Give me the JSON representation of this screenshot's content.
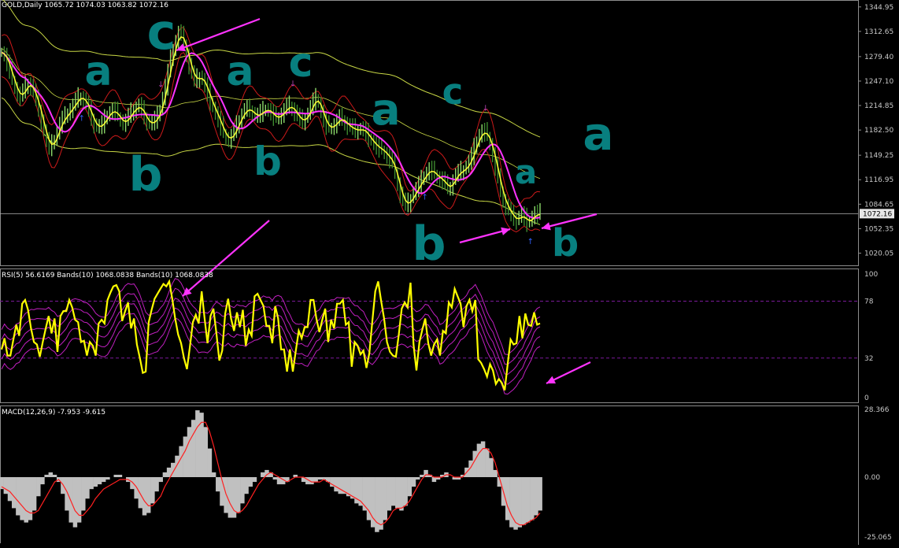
{
  "headers": {
    "price": "GOLD,Daily  1065.72 1074.03 1063.82 1072.16",
    "rsi": "RSI(5) 56.6169  Bands(10) 1068.0838  Bands(10) 1068.0838",
    "macd": "MACD(12,26,9) -7.953 -9.615"
  },
  "colors": {
    "background": "#000000",
    "candle_up": "#8cd96a",
    "candle_down": "#3d8a2f",
    "ma_fast": "#ffff33",
    "ma_slow": "#ff33ff",
    "envelope": "#cc1a1a",
    "channel": "#c9d845",
    "rsi": "#ffff00",
    "rsi_bands": "#c020c0",
    "macd_hist": "#c0c0c0",
    "macd_signal": "#ff2020",
    "annotation": "#ff33ff",
    "teal": "#087f7f",
    "axis_text": "#c8c8c8"
  },
  "chart_data": [
    {
      "type": "candlestick",
      "title": "GOLD,Daily",
      "ohlc_last": {
        "open": 1065.72,
        "high": 1074.03,
        "low": 1063.82,
        "close": 1072.16
      },
      "ylim": [
        1005,
        1352
      ],
      "ytick_labels": [
        "1344.95",
        "1312.65",
        "1279.40",
        "1247.10",
        "1214.85",
        "1182.50",
        "1149.25",
        "1116.95",
        "1084.65",
        "1052.35",
        "1020.05"
      ],
      "current_price_label": "1072.16",
      "close_series": [
        1285,
        1281,
        1270,
        1262,
        1248,
        1238,
        1230,
        1226,
        1232,
        1240,
        1244,
        1240,
        1232,
        1222,
        1210,
        1195,
        1180,
        1168,
        1160,
        1163,
        1170,
        1180,
        1190,
        1196,
        1200,
        1205,
        1210,
        1214,
        1220,
        1225,
        1226,
        1222,
        1216,
        1208,
        1198,
        1190,
        1186,
        1187,
        1190,
        1196,
        1202,
        1206,
        1208,
        1206,
        1200,
        1195,
        1192,
        1194,
        1200,
        1205,
        1210,
        1212,
        1214,
        1208,
        1200,
        1194,
        1190,
        1192,
        1196,
        1200,
        1210,
        1225,
        1240,
        1258,
        1275,
        1290,
        1300,
        1310,
        1306,
        1296,
        1282,
        1268,
        1256,
        1248,
        1250,
        1253,
        1248,
        1240,
        1230,
        1220,
        1212,
        1204,
        1196,
        1187,
        1178,
        1172,
        1170,
        1174,
        1180,
        1188,
        1196,
        1203,
        1208,
        1210,
        1209,
        1205,
        1200,
        1202,
        1205,
        1207,
        1210,
        1208,
        1205,
        1200,
        1198,
        1200,
        1204,
        1208,
        1212,
        1214,
        1211,
        1206,
        1200,
        1196,
        1194,
        1198,
        1204,
        1212,
        1220,
        1224,
        1218,
        1206,
        1196,
        1188,
        1185,
        1186,
        1190,
        1194,
        1198,
        1196,
        1192,
        1188,
        1186,
        1184,
        1182,
        1182,
        1184,
        1182,
        1178,
        1172,
        1168,
        1164,
        1160,
        1158,
        1156,
        1152,
        1148,
        1144,
        1138,
        1126,
        1112,
        1098,
        1088,
        1084,
        1086,
        1092,
        1098,
        1104,
        1110,
        1116,
        1122,
        1126,
        1130,
        1128,
        1124,
        1120,
        1118,
        1116,
        1110,
        1106,
        1108,
        1116,
        1122,
        1126,
        1128,
        1130,
        1134,
        1140,
        1148,
        1158,
        1168,
        1176,
        1180,
        1179,
        1174,
        1164,
        1150,
        1134,
        1118,
        1102,
        1090,
        1082,
        1076,
        1070,
        1066,
        1063,
        1068,
        1070,
        1066,
        1060,
        1063,
        1068,
        1072,
        1070,
        1072
      ],
      "overlays": [
        "moving average (yellow)",
        "moving average (magenta)",
        "envelope bands (red)",
        "channel (yellow-green)"
      ],
      "annotations": {
        "wave_labels": [
          "c",
          "a",
          "a",
          "c",
          "b",
          "b",
          "a",
          "c",
          "b",
          "a",
          "b",
          "a",
          "b"
        ],
        "fractal_marker": "↑",
        "arrows": 4
      }
    },
    {
      "type": "line",
      "title": "RSI(5) with Bands(10)",
      "series_name": "RSI(5)",
      "last_value": 56.6169,
      "ylim": [
        0,
        100
      ],
      "ytick_labels": [
        "100",
        "78",
        "32",
        "0"
      ],
      "levels": [
        78,
        32
      ],
      "values": [
        39,
        48,
        34,
        34,
        47,
        59,
        50,
        76,
        79,
        71,
        56,
        45,
        43,
        33,
        45,
        56,
        66,
        52,
        64,
        37,
        66,
        70,
        70,
        79,
        73,
        63,
        61,
        45,
        46,
        34,
        45,
        42,
        34,
        60,
        63,
        60,
        79,
        85,
        90,
        91,
        86,
        62,
        70,
        77,
        56,
        64,
        43,
        32,
        20,
        21,
        61,
        71,
        80,
        84,
        88,
        92,
        90,
        94,
        80,
        64,
        51,
        44,
        32,
        23,
        41,
        61,
        67,
        60,
        86,
        64,
        44,
        66,
        72,
        52,
        30,
        38,
        68,
        80,
        64,
        54,
        69,
        57,
        71,
        42,
        55,
        50,
        82,
        84,
        79,
        74,
        58,
        58,
        44,
        74,
        64,
        39,
        39,
        21,
        39,
        21,
        38,
        54,
        48,
        57,
        57,
        79,
        79,
        64,
        53,
        63,
        72,
        45,
        63,
        56,
        76,
        76,
        79,
        59,
        61,
        25,
        45,
        42,
        35,
        38,
        24,
        36,
        62,
        86,
        94,
        78,
        64,
        45,
        37,
        34,
        33,
        51,
        72,
        77,
        73,
        93,
        43,
        22,
        45,
        55,
        64,
        44,
        34,
        43,
        47,
        34,
        54,
        52,
        77,
        73,
        88,
        82,
        76,
        57,
        74,
        79,
        70,
        79,
        31,
        28,
        23,
        17,
        27,
        22,
        11,
        15,
        12,
        6,
        27,
        47,
        43,
        44,
        66,
        48,
        68,
        59,
        58,
        69,
        59,
        60
      ],
      "bands_note": "five magenta envelope lines"
    },
    {
      "type": "bar",
      "title": "MACD(12,26,9)",
      "main_value": -7.953,
      "signal_value": -9.615,
      "ylim": [
        -25.065,
        28.366
      ],
      "ytick_labels": [
        "28.366",
        "0.00",
        "-25.065"
      ],
      "histogram": [
        -5,
        -7,
        -10,
        -13,
        -16,
        -18,
        -19,
        -18,
        -14,
        -8,
        -3,
        1,
        2,
        1,
        -2,
        -7,
        -14,
        -19,
        -21,
        -19,
        -14,
        -9,
        -5,
        -4,
        -3,
        -2,
        -1,
        0,
        1,
        1,
        0,
        -2,
        -5,
        -9,
        -13,
        -16,
        -15,
        -11,
        -6,
        -2,
        2,
        4,
        6,
        9,
        13,
        17,
        21,
        24,
        28,
        27,
        21,
        12,
        2,
        -6,
        -12,
        -15,
        -17,
        -17,
        -15,
        -11,
        -7,
        -4,
        -2,
        0,
        2,
        3,
        2,
        -1,
        -3,
        -3,
        -2,
        0,
        1,
        0,
        -2,
        -3,
        -3,
        -2,
        -1,
        -1,
        -2,
        -4,
        -6,
        -7,
        -7,
        -8,
        -9,
        -11,
        -12,
        -14,
        -18,
        -21,
        -23,
        -22,
        -18,
        -14,
        -12,
        -13,
        -14,
        -12,
        -8,
        -4,
        -1,
        1,
        3,
        1,
        -2,
        -1,
        1,
        2,
        0,
        -1,
        -1,
        1,
        4,
        7,
        11,
        14,
        15,
        12,
        8,
        3,
        -4,
        -12,
        -18,
        -21,
        -22,
        -21,
        -20,
        -19,
        -18,
        -16,
        -14
      ],
      "signal": [
        -4,
        -5,
        -6,
        -8,
        -10,
        -12,
        -14,
        -15,
        -15,
        -14,
        -11,
        -8,
        -5,
        -2,
        -1,
        -3,
        -6,
        -10,
        -14,
        -16,
        -16,
        -14,
        -12,
        -9,
        -7,
        -5,
        -4,
        -3,
        -2,
        -1,
        -1,
        -1,
        -2,
        -4,
        -7,
        -10,
        -12,
        -12,
        -10,
        -8,
        -4,
        -1,
        2,
        5,
        8,
        11,
        15,
        18,
        21,
        23,
        23,
        19,
        13,
        6,
        -1,
        -7,
        -11,
        -14,
        -15,
        -14,
        -12,
        -9,
        -6,
        -3,
        -1,
        1,
        2,
        1,
        0,
        -1,
        -2,
        -1,
        0,
        0,
        0,
        -1,
        -2,
        -2,
        -2,
        -1,
        -2,
        -3,
        -4,
        -5,
        -6,
        -7,
        -8,
        -9,
        -10,
        -12,
        -14,
        -17,
        -19,
        -20,
        -19,
        -17,
        -14,
        -13,
        -13,
        -12,
        -10,
        -7,
        -4,
        -1,
        1,
        1,
        0,
        0,
        0,
        1,
        1,
        0,
        0,
        0,
        2,
        4,
        7,
        10,
        12,
        12,
        10,
        6,
        0,
        -6,
        -12,
        -16,
        -19,
        -20,
        -20,
        -19,
        -18,
        -17,
        -15
      ]
    }
  ]
}
